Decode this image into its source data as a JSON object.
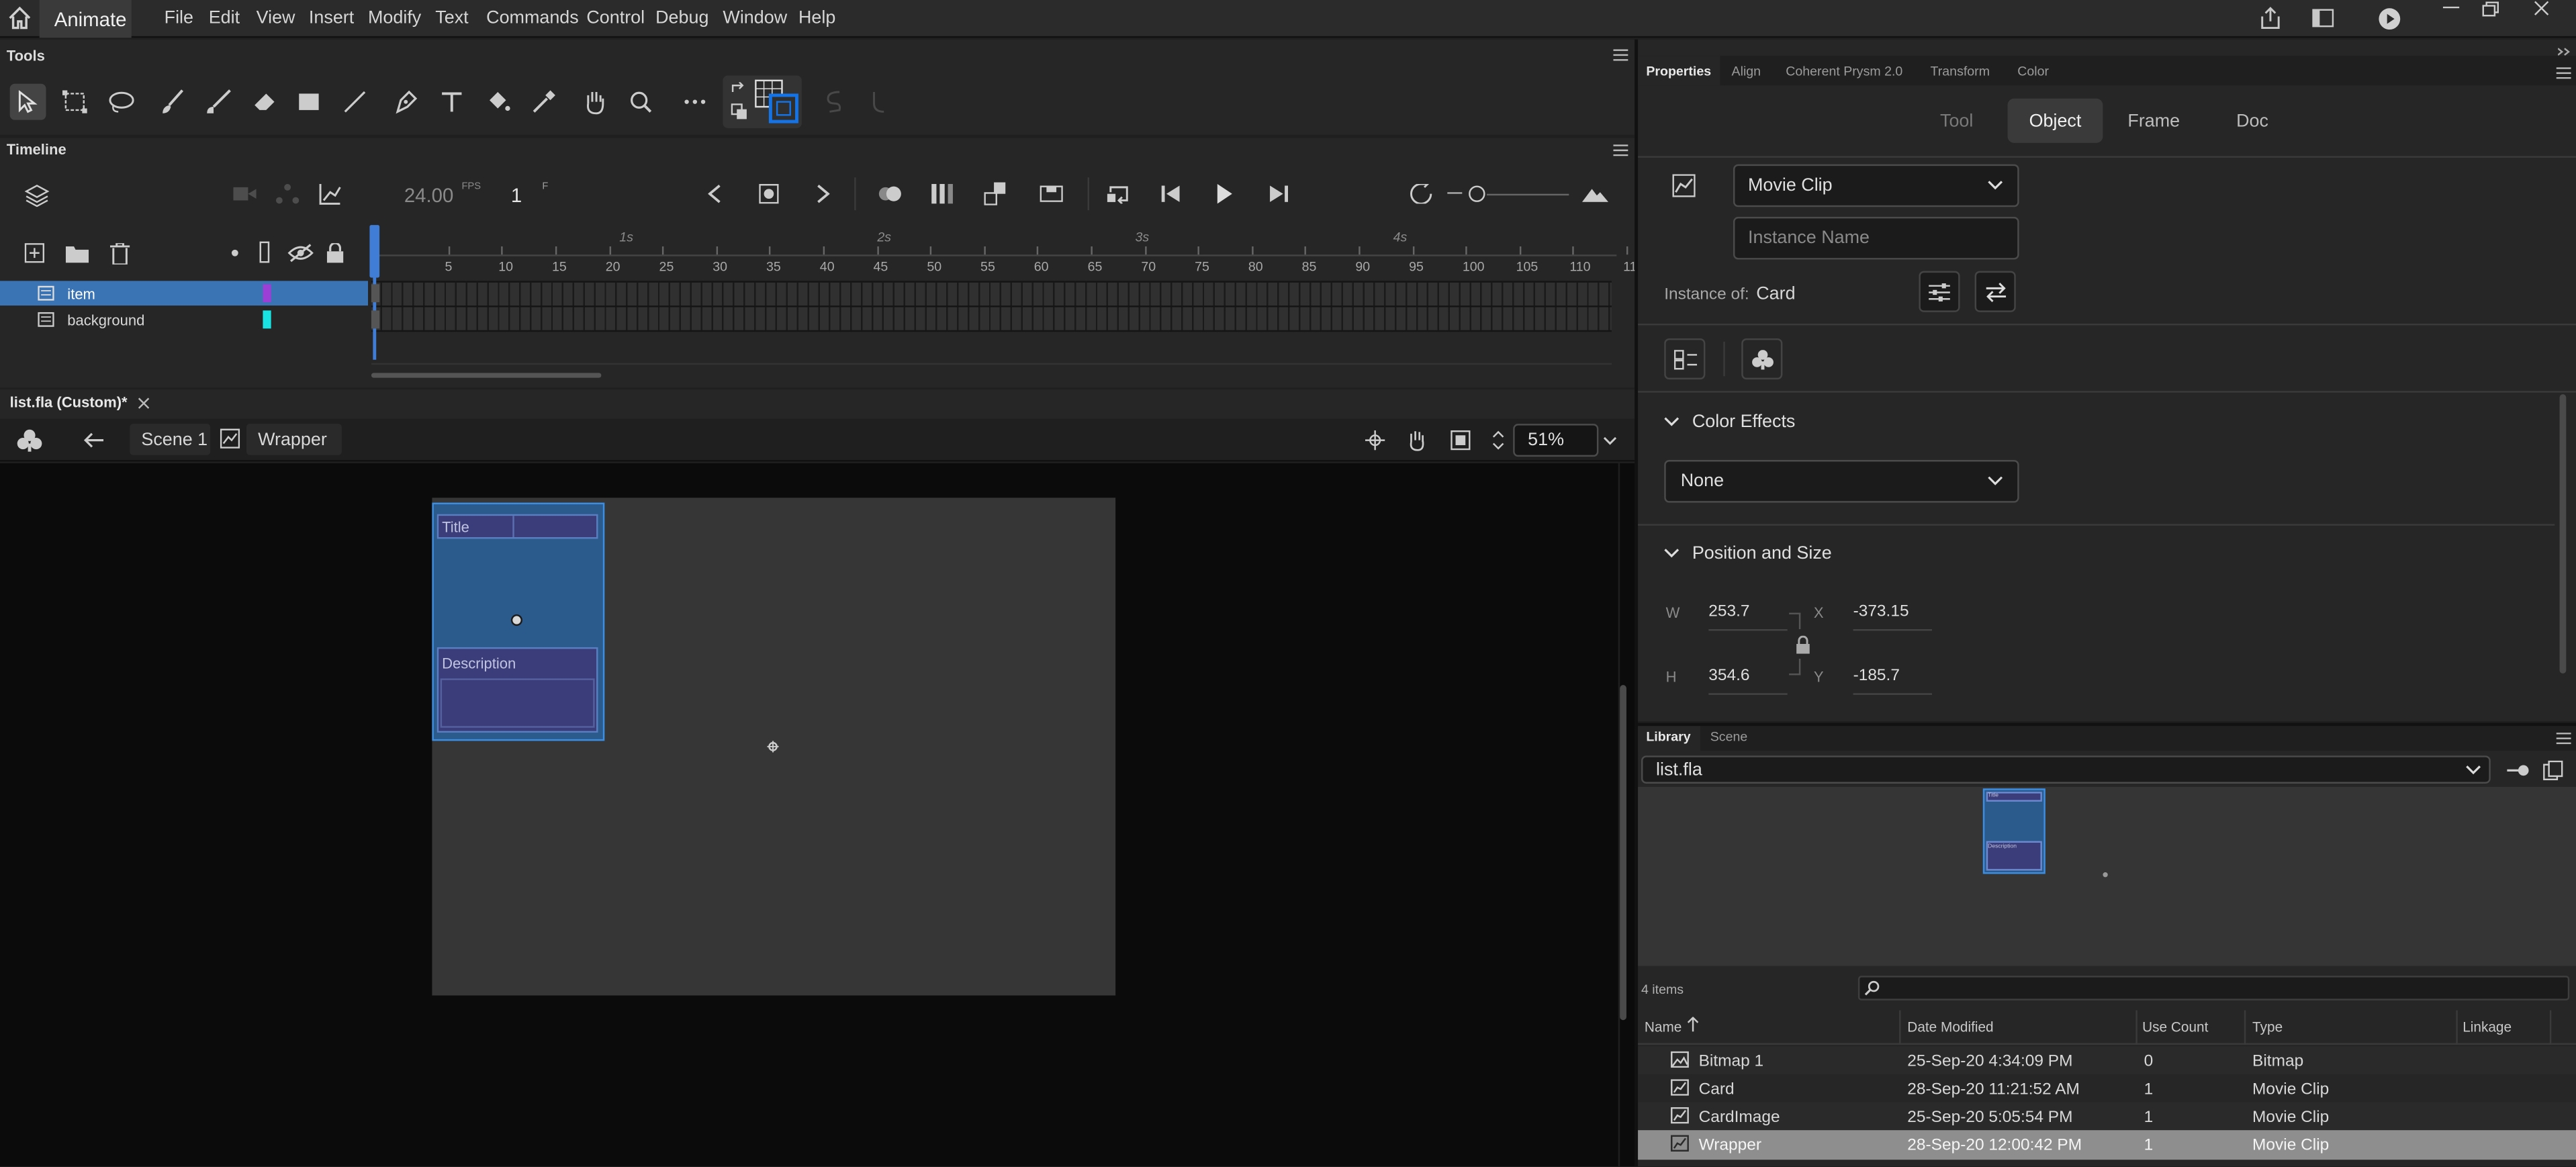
{
  "app": {
    "name": "Animate"
  },
  "menu": [
    "File",
    "Edit",
    "View",
    "Insert",
    "Modify",
    "Text",
    "Commands",
    "Control",
    "Debug",
    "Window",
    "Help"
  ],
  "tools": {
    "title": "Tools"
  },
  "timeline": {
    "title": "Timeline",
    "fps": "24.00",
    "fps_unit": "FPS",
    "frame": "1",
    "frame_unit": "F",
    "layers": [
      {
        "name": "item",
        "color": "#9b3fd6",
        "selected": true
      },
      {
        "name": "background",
        "color": "#19e3e3",
        "selected": false
      }
    ],
    "frame_ticks": [
      "5",
      "10",
      "15",
      "20",
      "25",
      "30",
      "35",
      "40",
      "45",
      "50",
      "55",
      "60",
      "65",
      "70",
      "75",
      "80",
      "85",
      "90",
      "95",
      "100",
      "105",
      "110",
      "11"
    ],
    "second_ticks": [
      "1s",
      "2s",
      "3s",
      "4s"
    ]
  },
  "document": {
    "tab": "list.fla (Custom)*",
    "scene": "Scene 1",
    "symbol": "Wrapper",
    "zoom": "51%"
  },
  "stage": {
    "title_label": "Title",
    "description_label": "Description"
  },
  "properties": {
    "tabs": [
      "Properties",
      "Align",
      "Coherent Prysm 2.0",
      "Transform",
      "Color"
    ],
    "segments": [
      "Tool",
      "Object",
      "Frame",
      "Doc"
    ],
    "active_segment": "Object",
    "symbol_type": "Movie Clip",
    "instance_placeholder": "Instance Name",
    "instance_of_label": "Instance of:",
    "instance_of": "Card",
    "color_effects": {
      "title": "Color Effects",
      "value": "None"
    },
    "position_size": {
      "title": "Position and Size",
      "w_label": "W",
      "w": "253.7",
      "h_label": "H",
      "h": "354.6",
      "x_label": "X",
      "x": "-373.15",
      "y_label": "Y",
      "y": "-185.7"
    }
  },
  "library": {
    "tabs": [
      "Library",
      "Scene"
    ],
    "document": "list.fla",
    "count": "4 items",
    "preview": {
      "title_label": "Title",
      "description_label": "Description"
    },
    "columns": [
      "Name",
      "Date Modified",
      "Use Count",
      "Type",
      "Linkage"
    ],
    "items": [
      {
        "name": "Bitmap 1",
        "date": "25-Sep-20 4:34:09 PM",
        "count": "0",
        "type": "Bitmap",
        "icon": "bitmap-icon"
      },
      {
        "name": "Card",
        "date": "28-Sep-20 11:21:52 AM",
        "count": "1",
        "type": "Movie Clip",
        "icon": "movieclip-icon"
      },
      {
        "name": "CardImage",
        "date": "25-Sep-20 5:05:54 PM",
        "count": "1",
        "type": "Movie Clip",
        "icon": "movieclip-icon"
      },
      {
        "name": "Wrapper",
        "date": "28-Sep-20 12:00:42 PM",
        "count": "1",
        "type": "Movie Clip",
        "icon": "movieclip-icon"
      }
    ]
  },
  "colors": {
    "accent": "#1473e6",
    "selection": "#3a74b4",
    "symbol_fill": "#2b5a8c",
    "text_box_fill": "#3b3d7a"
  }
}
